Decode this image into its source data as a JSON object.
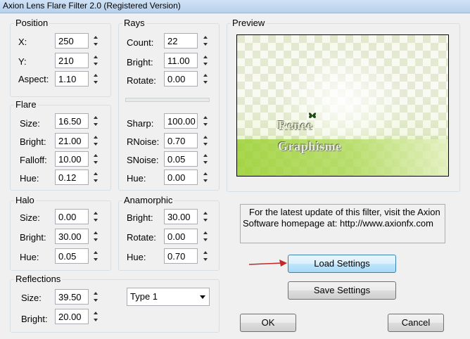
{
  "window": {
    "title": "Axion Lens Flare Filter 2.0 (Registered Version)"
  },
  "position": {
    "title": "Position",
    "fields": [
      {
        "label": "X:",
        "value": "250"
      },
      {
        "label": "Y:",
        "value": "210"
      },
      {
        "label": "Aspect:",
        "value": "1.10"
      }
    ]
  },
  "rays": {
    "title": "Rays",
    "fields": [
      {
        "label": "Count:",
        "value": "22"
      },
      {
        "label": "Bright:",
        "value": "11.00"
      },
      {
        "label": "Rotate:",
        "value": "0.00"
      },
      {
        "label": "Sharp:",
        "value": "100.00"
      },
      {
        "label": "RNoise:",
        "value": "0.70"
      },
      {
        "label": "SNoise:",
        "value": "0.05"
      },
      {
        "label": "Hue:",
        "value": "0.00"
      }
    ]
  },
  "flare": {
    "title": "Flare",
    "fields": [
      {
        "label": "Size:",
        "value": "16.50"
      },
      {
        "label": "Bright:",
        "value": "21.00"
      },
      {
        "label": "Falloff:",
        "value": "10.00"
      },
      {
        "label": "Hue:",
        "value": "0.12"
      }
    ]
  },
  "halo": {
    "title": "Halo",
    "fields": [
      {
        "label": "Size:",
        "value": "0.00"
      },
      {
        "label": "Bright:",
        "value": "30.00"
      },
      {
        "label": "Hue:",
        "value": "0.05"
      }
    ]
  },
  "anamorphic": {
    "title": "Anamorphic",
    "fields": [
      {
        "label": "Bright:",
        "value": "30.00"
      },
      {
        "label": "Rotate:",
        "value": "0.00"
      },
      {
        "label": "Hue:",
        "value": "0.70"
      }
    ]
  },
  "reflections": {
    "title": "Reflections",
    "fields": [
      {
        "label": "Size:",
        "value": "39.50"
      },
      {
        "label": "Bright:",
        "value": "20.00"
      }
    ],
    "type_selected": "Type 1"
  },
  "preview": {
    "title": "Preview",
    "watermark_line1": "Renee",
    "watermark_line2": "Graphisme"
  },
  "info": {
    "line1": "For the latest update of this filter, visit the Axion",
    "line2": "Software homepage at: http://www.axionfx.com"
  },
  "buttons": {
    "load": "Load Settings",
    "save": "Save Settings",
    "ok": "OK",
    "cancel": "Cancel"
  },
  "colors": {
    "accent_arrow": "#c0282a",
    "preview_green": "#a9d443"
  }
}
